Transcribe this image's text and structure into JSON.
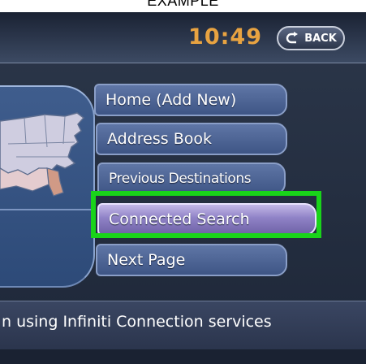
{
  "caption": "EXAMPLE",
  "header": {
    "clock": "10:49",
    "back_label": "BACK"
  },
  "menu": {
    "items": [
      {
        "label": "Home (Add New)"
      },
      {
        "label": "Address Book"
      },
      {
        "label": "Previous Destinations"
      },
      {
        "label": "Connected Search",
        "selected": true
      },
      {
        "label": "Next Page"
      }
    ]
  },
  "status": {
    "text": "n using Infiniti Connection services"
  },
  "colors": {
    "clock": "#e8a341",
    "highlight": "#19d41a",
    "selected_item": "#8f82c6",
    "menu_item": "#4f669a"
  },
  "icons": {
    "back": "u-turn-arrow-icon",
    "map": "us-map-icon"
  }
}
